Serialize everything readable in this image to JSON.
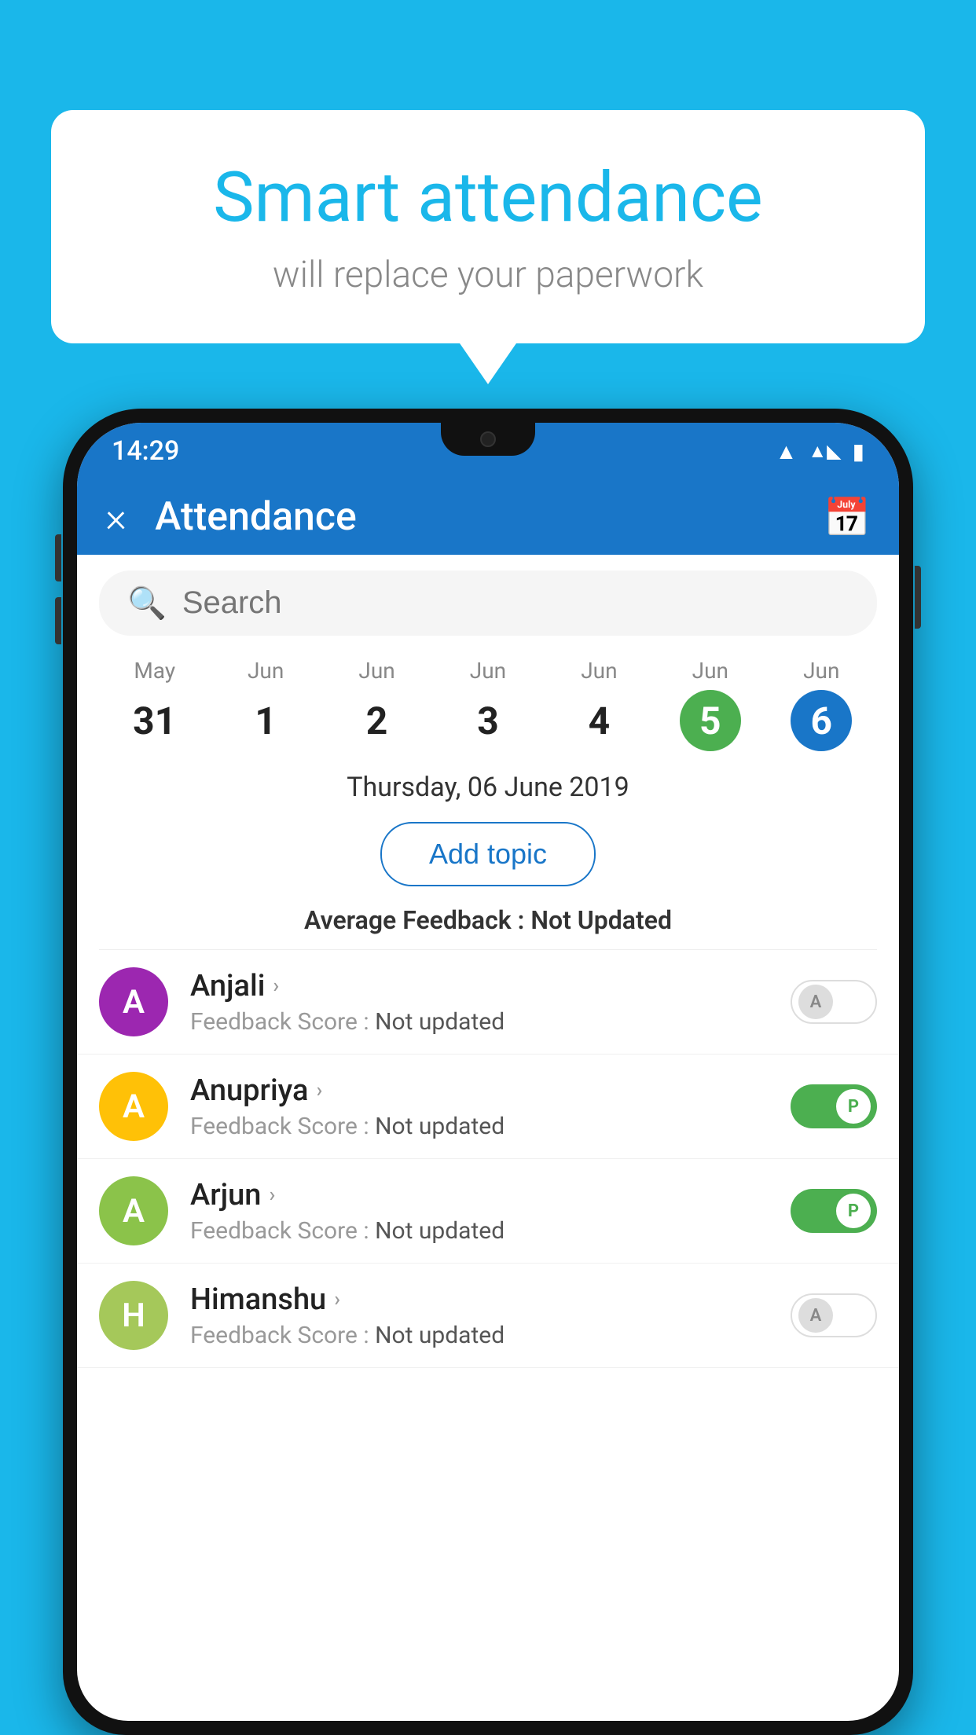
{
  "background_color": "#1ab7ea",
  "bubble": {
    "title": "Smart attendance",
    "subtitle": "will replace your paperwork"
  },
  "status_bar": {
    "time": "14:29",
    "icons": [
      "wifi",
      "signal",
      "battery"
    ]
  },
  "app_bar": {
    "title": "Attendance",
    "close_label": "×",
    "calendar_icon": "📅"
  },
  "search": {
    "placeholder": "Search"
  },
  "dates": [
    {
      "month": "May",
      "day": "31",
      "state": "normal"
    },
    {
      "month": "Jun",
      "day": "1",
      "state": "normal"
    },
    {
      "month": "Jun",
      "day": "2",
      "state": "normal"
    },
    {
      "month": "Jun",
      "day": "3",
      "state": "normal"
    },
    {
      "month": "Jun",
      "day": "4",
      "state": "normal"
    },
    {
      "month": "Jun",
      "day": "5",
      "state": "today"
    },
    {
      "month": "Jun",
      "day": "6",
      "state": "selected"
    }
  ],
  "selected_date_label": "Thursday, 06 June 2019",
  "add_topic_label": "Add topic",
  "avg_feedback": {
    "label": "Average Feedback : ",
    "value": "Not Updated"
  },
  "students": [
    {
      "name": "Anjali",
      "avatar_letter": "A",
      "avatar_color": "#9c27b0",
      "feedback": "Feedback Score : ",
      "feedback_value": "Not updated",
      "toggle": "off",
      "toggle_label": "A"
    },
    {
      "name": "Anupriya",
      "avatar_letter": "A",
      "avatar_color": "#ffc107",
      "feedback": "Feedback Score : ",
      "feedback_value": "Not updated",
      "toggle": "on",
      "toggle_label": "P"
    },
    {
      "name": "Arjun",
      "avatar_letter": "A",
      "avatar_color": "#8bc34a",
      "feedback": "Feedback Score : ",
      "feedback_value": "Not updated",
      "toggle": "on",
      "toggle_label": "P"
    },
    {
      "name": "Himanshu",
      "avatar_letter": "H",
      "avatar_color": "#a5c85a",
      "feedback": "Feedback Score : ",
      "feedback_value": "Not updated",
      "toggle": "off",
      "toggle_label": "A"
    }
  ]
}
